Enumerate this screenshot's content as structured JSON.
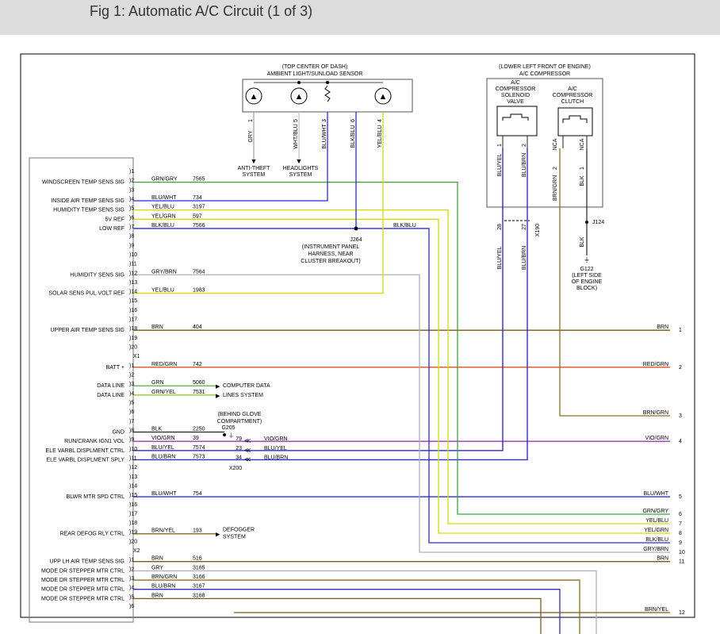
{
  "header": {
    "title": "Fig 1: Automatic A/C Circuit (1 of 3)"
  },
  "colors": {
    "frame": "#000000",
    "wire_blu": "#2b2bd8",
    "wire_grn": "#3aa33a",
    "wire_yel": "#d9d900",
    "wire_brn": "#7a5a10",
    "wire_red": "#e05020",
    "wire_vio": "#a030c0",
    "wire_gry": "#b0b0b0",
    "wire_brngrn": "#8a7020",
    "wire_blk": "#222222",
    "wire_grnyel": "#8cc020"
  },
  "components": {
    "sunload_sensor": {
      "location": "(TOP CENTER OF DASH)",
      "name": "AMBIENT LIGHT/SUNLOAD SENSOR",
      "pins": [
        {
          "num": "1",
          "color": "GRY"
        },
        {
          "num": "5",
          "color": "WHT/BLU"
        },
        {
          "num": "3",
          "color": "BLU/WHT"
        },
        {
          "num": "6",
          "color": "BLK/BLU"
        },
        {
          "num": "4",
          "color": "YEL/BLU"
        }
      ],
      "anti_theft": "ANTI-THEFT SYSTEM",
      "headlights": "HEADLIGHTS SYSTEM"
    },
    "compressor": {
      "location": "(LOWER LEFT FRONT OF ENGINE)",
      "name": "A/C COMPRESSOR",
      "solenoid": "A/C COMPRESSOR SOLENOID VALVE",
      "clutch": "A/C COMPRESSOR CLUTCH",
      "solenoid_pins": [
        {
          "num": "1",
          "color": "BLU/YEL"
        },
        {
          "num": "2",
          "color": "BLU/BRN"
        }
      ],
      "clutch_pins": [
        {
          "num": "2",
          "color": "BRN/GRN",
          "nca": "NCA"
        },
        {
          "num": "1",
          "color": "BLK",
          "nca": "NCA"
        }
      ],
      "x190": {
        "label": "X190",
        "pins": [
          "28",
          "27"
        ],
        "colors": [
          "BLU/YEL",
          "BLU/BRN"
        ]
      },
      "j124": "J124",
      "blk": "BLK",
      "g122": "G122 (LEFT SIDE OF ENGINE BLOCK)"
    },
    "j264": {
      "label": "J264",
      "desc": "(INSTRUMENT PANEL HARNESS, NEAR CLUSTER BREAKOUT)"
    },
    "g205": {
      "desc": "(BEHIND GLOVE COMPARTMENT)",
      "label": "G205"
    },
    "x200": {
      "label": "X200"
    },
    "computer_data": "COMPUTER DATA LINES SYSTEM",
    "defogger": "DEFOGGER SYSTEM"
  },
  "connectors": [
    "X1",
    "X2"
  ],
  "pins": [
    {
      "n": "1",
      "label": "",
      "color": "",
      "circuit": ""
    },
    {
      "n": "2",
      "label": "WINDSCREEN TEMP SENS SIG",
      "color": "GRN/GRY",
      "circuit": "7565"
    },
    {
      "n": "3",
      "label": "",
      "color": "",
      "circuit": ""
    },
    {
      "n": "4",
      "label": "INSIDE AIR TEMP SENS SIG",
      "color": "BLU/WHT",
      "circuit": "734"
    },
    {
      "n": "5",
      "label": "HUMIDITY TEMP SENS SIG",
      "color": "YEL/BLU",
      "circuit": "3197"
    },
    {
      "n": "6",
      "label": "5V REF",
      "color": "YEL/GRN",
      "circuit": "597"
    },
    {
      "n": "7",
      "label": "LOW REF",
      "color": "BLK/BLU",
      "circuit": "7566"
    },
    {
      "n": "8",
      "label": "",
      "color": "",
      "circuit": ""
    },
    {
      "n": "9",
      "label": "",
      "color": "",
      "circuit": ""
    },
    {
      "n": "10",
      "label": "",
      "color": "",
      "circuit": ""
    },
    {
      "n": "11",
      "label": "",
      "color": "",
      "circuit": ""
    },
    {
      "n": "12",
      "label": "HUMIDITY SENS SIG",
      "color": "GRY/BRN",
      "circuit": "7564"
    },
    {
      "n": "13",
      "label": "",
      "color": "",
      "circuit": ""
    },
    {
      "n": "14",
      "label": "SOLAR SENS PUL VOLT REF",
      "color": "YEL/BLU",
      "circuit": "1983"
    },
    {
      "n": "15",
      "label": "",
      "color": "",
      "circuit": ""
    },
    {
      "n": "16",
      "label": "",
      "color": "",
      "circuit": ""
    },
    {
      "n": "17",
      "label": "",
      "color": "",
      "circuit": ""
    },
    {
      "n": "18",
      "label": "UPPER AIR TEMP SENS SIG",
      "color": "BRN",
      "circuit": "404"
    },
    {
      "n": "19",
      "label": "",
      "color": "",
      "circuit": ""
    },
    {
      "n": "20",
      "label": "",
      "color": "",
      "circuit": ""
    },
    {
      "n": "1",
      "label": "BATT +",
      "color": "RED/GRN",
      "circuit": "742"
    },
    {
      "n": "2",
      "label": "",
      "color": "",
      "circuit": ""
    },
    {
      "n": "3",
      "label": "DATA LINE",
      "color": "GRN",
      "circuit": "5060"
    },
    {
      "n": "4",
      "label": "DATA LINE",
      "color": "GRN/YEL",
      "circuit": "7531"
    },
    {
      "n": "5",
      "label": "",
      "color": "",
      "circuit": ""
    },
    {
      "n": "6",
      "label": "",
      "color": "",
      "circuit": ""
    },
    {
      "n": "7",
      "label": "",
      "color": "",
      "circuit": ""
    },
    {
      "n": "8",
      "label": "GND",
      "color": "BLK",
      "circuit": "2250"
    },
    {
      "n": "9",
      "label": "RUN/CRANK IGN1 VOL",
      "color": "VIO/GRN",
      "circuit": "39"
    },
    {
      "n": "10",
      "label": "ELE VARBL DISPLMENT CTRL",
      "color": "BLU/YEL",
      "circuit": "7574"
    },
    {
      "n": "11",
      "label": "ELE VARBL DISPLMENT SPLY",
      "color": "BLU/BRN",
      "circuit": "7573"
    },
    {
      "n": "12",
      "label": "",
      "color": "",
      "circuit": ""
    },
    {
      "n": "13",
      "label": "",
      "color": "",
      "circuit": ""
    },
    {
      "n": "14",
      "label": "",
      "color": "",
      "circuit": ""
    },
    {
      "n": "15",
      "label": "BLWR MTR SPD CTRL",
      "color": "BLU/WHT",
      "circuit": "754"
    },
    {
      "n": "16",
      "label": "",
      "color": "",
      "circuit": ""
    },
    {
      "n": "17",
      "label": "",
      "color": "",
      "circuit": ""
    },
    {
      "n": "18",
      "label": "",
      "color": "",
      "circuit": ""
    },
    {
      "n": "19",
      "label": "REAR DEFOG RLY CTRL",
      "color": "BRN/YEL",
      "circuit": "193"
    },
    {
      "n": "20",
      "label": "",
      "color": "",
      "circuit": ""
    },
    {
      "n": "1",
      "label": "UPP LH AIR TEMP SENS SIG",
      "color": "BRN",
      "circuit": "516"
    },
    {
      "n": "2",
      "label": "MODE DR STEPPER MTR CTRL",
      "color": "GRY",
      "circuit": "3165"
    },
    {
      "n": "3",
      "label": "MODE DR STEPPER MTR CTRL",
      "color": "BRN/GRN",
      "circuit": "3166"
    },
    {
      "n": "4",
      "label": "MODE DR STEPPER MTR CTRL",
      "color": "BLU/BRN",
      "circuit": "3167"
    },
    {
      "n": "5",
      "label": "MODE DR STEPPER MTR CTRL",
      "color": "BRN",
      "circuit": "3168"
    },
    {
      "n": "6",
      "label": "",
      "color": "",
      "circuit": ""
    }
  ],
  "x200_pins": [
    {
      "n": "79",
      "color": "VIO/GRN"
    },
    {
      "n": "23",
      "color": "BLU/YEL"
    },
    {
      "n": "34",
      "color": "BLU/BRN"
    }
  ],
  "outputs": [
    {
      "n": "1",
      "color": "BRN"
    },
    {
      "n": "2",
      "color": "RED/GRN"
    },
    {
      "n": "3",
      "color": "BRN/GRN"
    },
    {
      "n": "4",
      "color": "VIO/GRN"
    },
    {
      "n": "5",
      "color": "BLU/WHT"
    },
    {
      "n": "6",
      "color": "GRN/GRY"
    },
    {
      "n": "7",
      "color": "YEL/BLU"
    },
    {
      "n": "8",
      "color": "YEL/GRN"
    },
    {
      "n": "9",
      "color": "BLK/BLU"
    },
    {
      "n": "10",
      "color": "GRY/BRN"
    },
    {
      "n": "11",
      "color": "BRN"
    },
    {
      "n": "12",
      "color": "BRN/YEL"
    }
  ],
  "j264_wire": "BLK/BLU"
}
